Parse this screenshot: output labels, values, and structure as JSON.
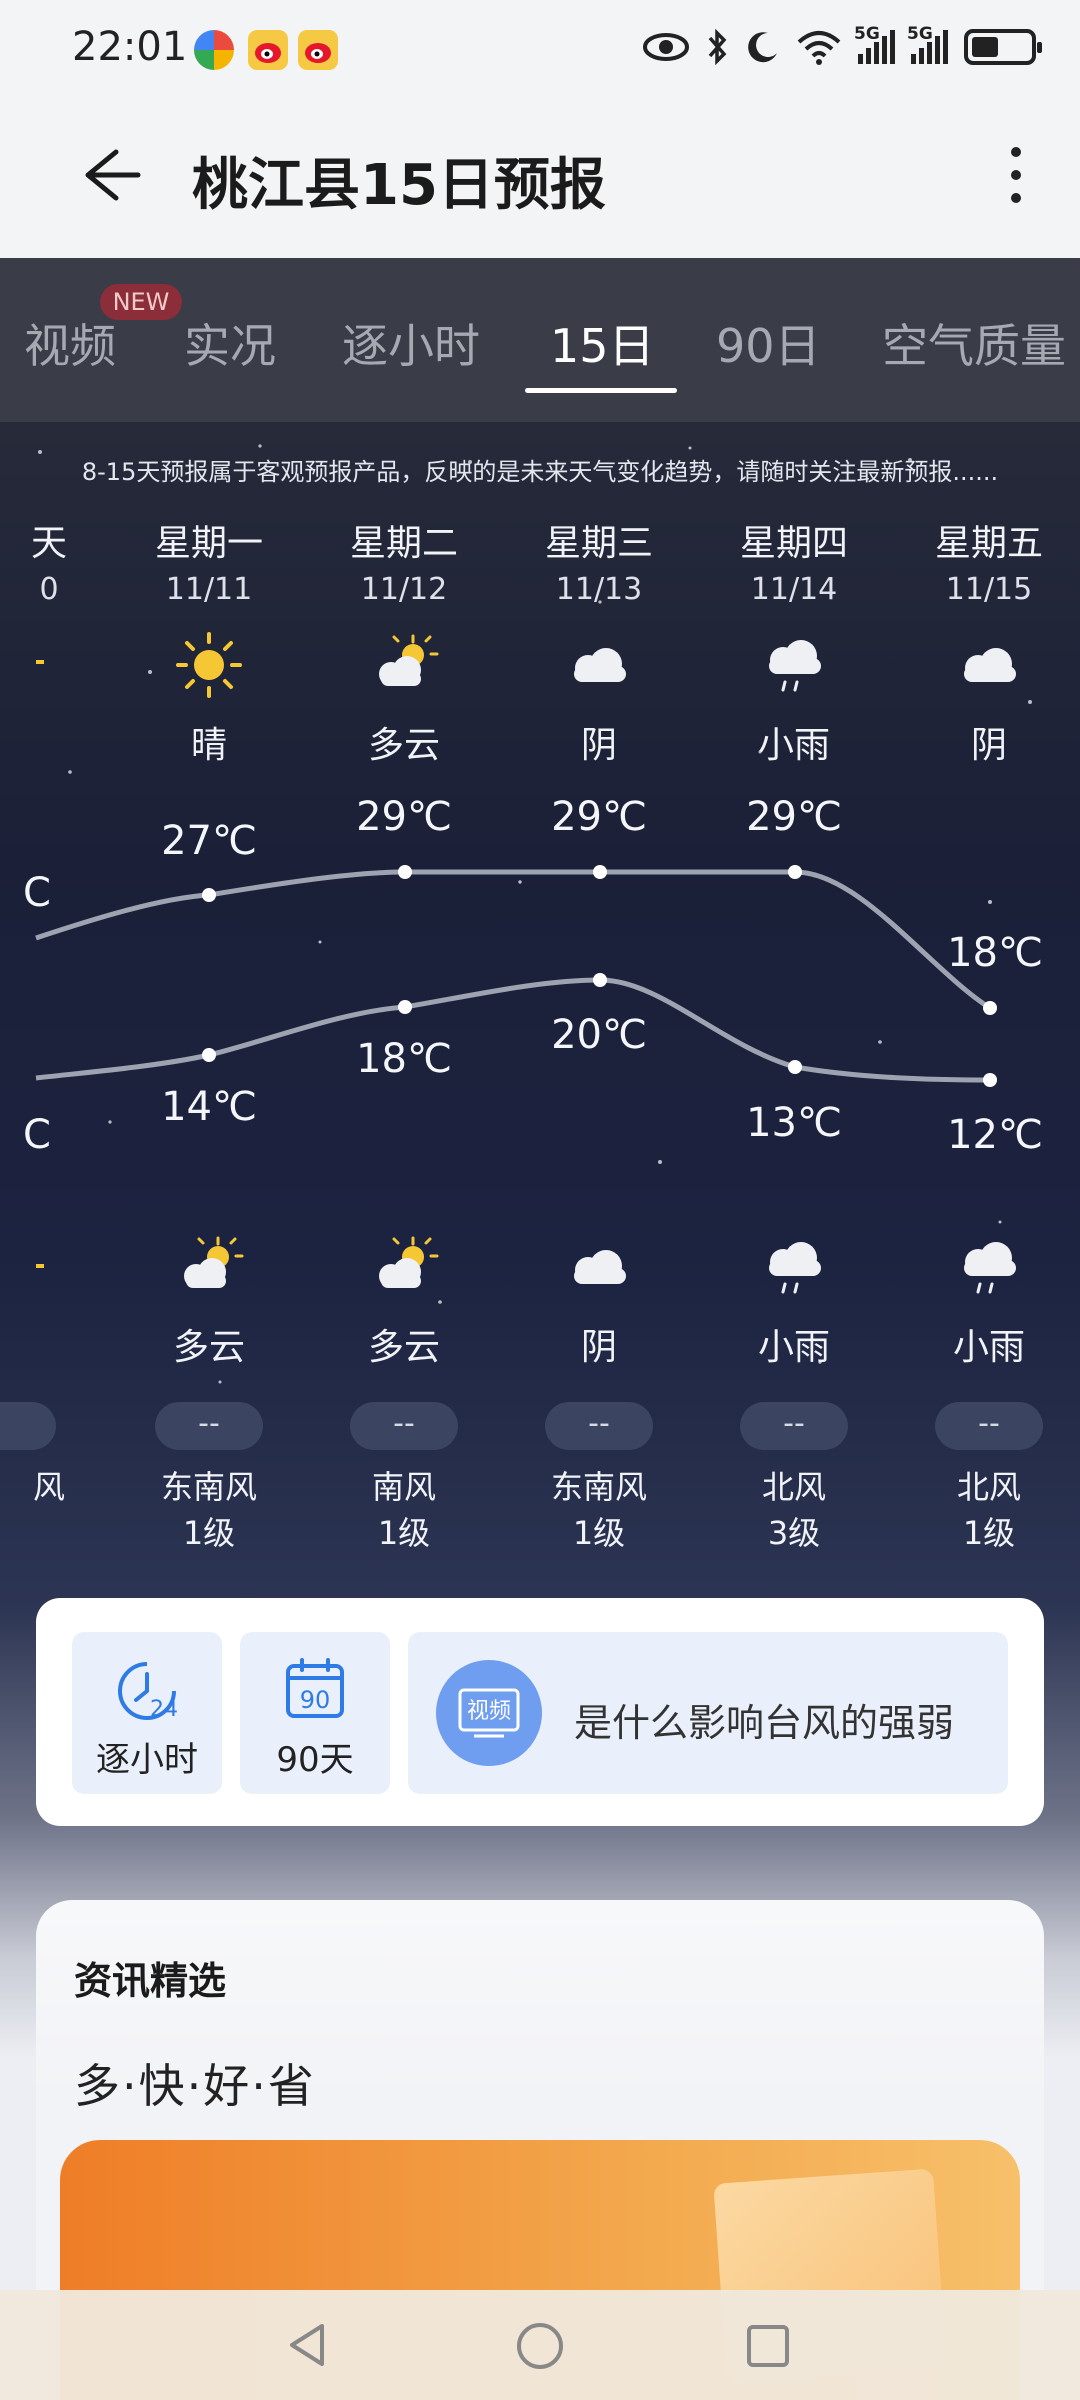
{
  "status_bar": {
    "time": "22:01",
    "network_1": "5G",
    "network_2": "5G"
  },
  "header": {
    "title": "桃江县15日预报"
  },
  "tabs": [
    {
      "label": "视频",
      "badge": "NEW"
    },
    {
      "label": "实况"
    },
    {
      "label": "逐小时"
    },
    {
      "label": "15日",
      "active": true
    },
    {
      "label": "90日"
    },
    {
      "label": "空气质量"
    }
  ],
  "notice": "8-15天预报属于客观预报产品，反映的是未来天气变化趋势，请随时关注最新预报......",
  "partial_day": {
    "dow": "天",
    "date": "0",
    "high": "C",
    "low": "C",
    "wind_dir": "风"
  },
  "days": [
    {
      "dow": "星期一",
      "date": "11/11",
      "day_icon": "sunny-icon",
      "day_cond": "晴",
      "high": "27℃",
      "low": "14℃",
      "night_icon": "partly-cloudy-icon",
      "night_cond": "多云",
      "aqi": "--",
      "wind_dir": "东南风",
      "wind_level": "1级"
    },
    {
      "dow": "星期二",
      "date": "11/12",
      "day_icon": "partly-cloudy-icon",
      "day_cond": "多云",
      "high": "29℃",
      "low": "18℃",
      "night_icon": "partly-cloudy-icon",
      "night_cond": "多云",
      "aqi": "--",
      "wind_dir": "南风",
      "wind_level": "1级"
    },
    {
      "dow": "星期三",
      "date": "11/13",
      "day_icon": "cloudy-icon",
      "day_cond": "阴",
      "high": "29℃",
      "low": "20℃",
      "night_icon": "cloudy-icon",
      "night_cond": "阴",
      "aqi": "--",
      "wind_dir": "东南风",
      "wind_level": "1级"
    },
    {
      "dow": "星期四",
      "date": "11/14",
      "day_icon": "light-rain-icon",
      "day_cond": "小雨",
      "high": "29℃",
      "low": "13℃",
      "night_icon": "light-rain-icon",
      "night_cond": "小雨",
      "aqi": "--",
      "wind_dir": "北风",
      "wind_level": "3级"
    },
    {
      "dow": "星期五",
      "date": "11/15",
      "day_icon": "cloudy-icon",
      "day_cond": "阴",
      "high": "18℃",
      "low": "12℃",
      "night_icon": "light-rain-icon",
      "night_cond": "小雨",
      "aqi": "--",
      "wind_dir": "北风",
      "wind_level": "1级"
    }
  ],
  "quick_links": {
    "hourly": {
      "icon": "clock-24-icon",
      "icon_text": "24",
      "label": "逐小时"
    },
    "days90": {
      "icon": "calendar-90-icon",
      "icon_text": "90",
      "label": "90天"
    },
    "video": {
      "icon_text": "视频",
      "text": "是什么影响台风的强弱"
    }
  },
  "news": {
    "title": "资讯精选",
    "subtitle": "多·快·好·省"
  }
}
